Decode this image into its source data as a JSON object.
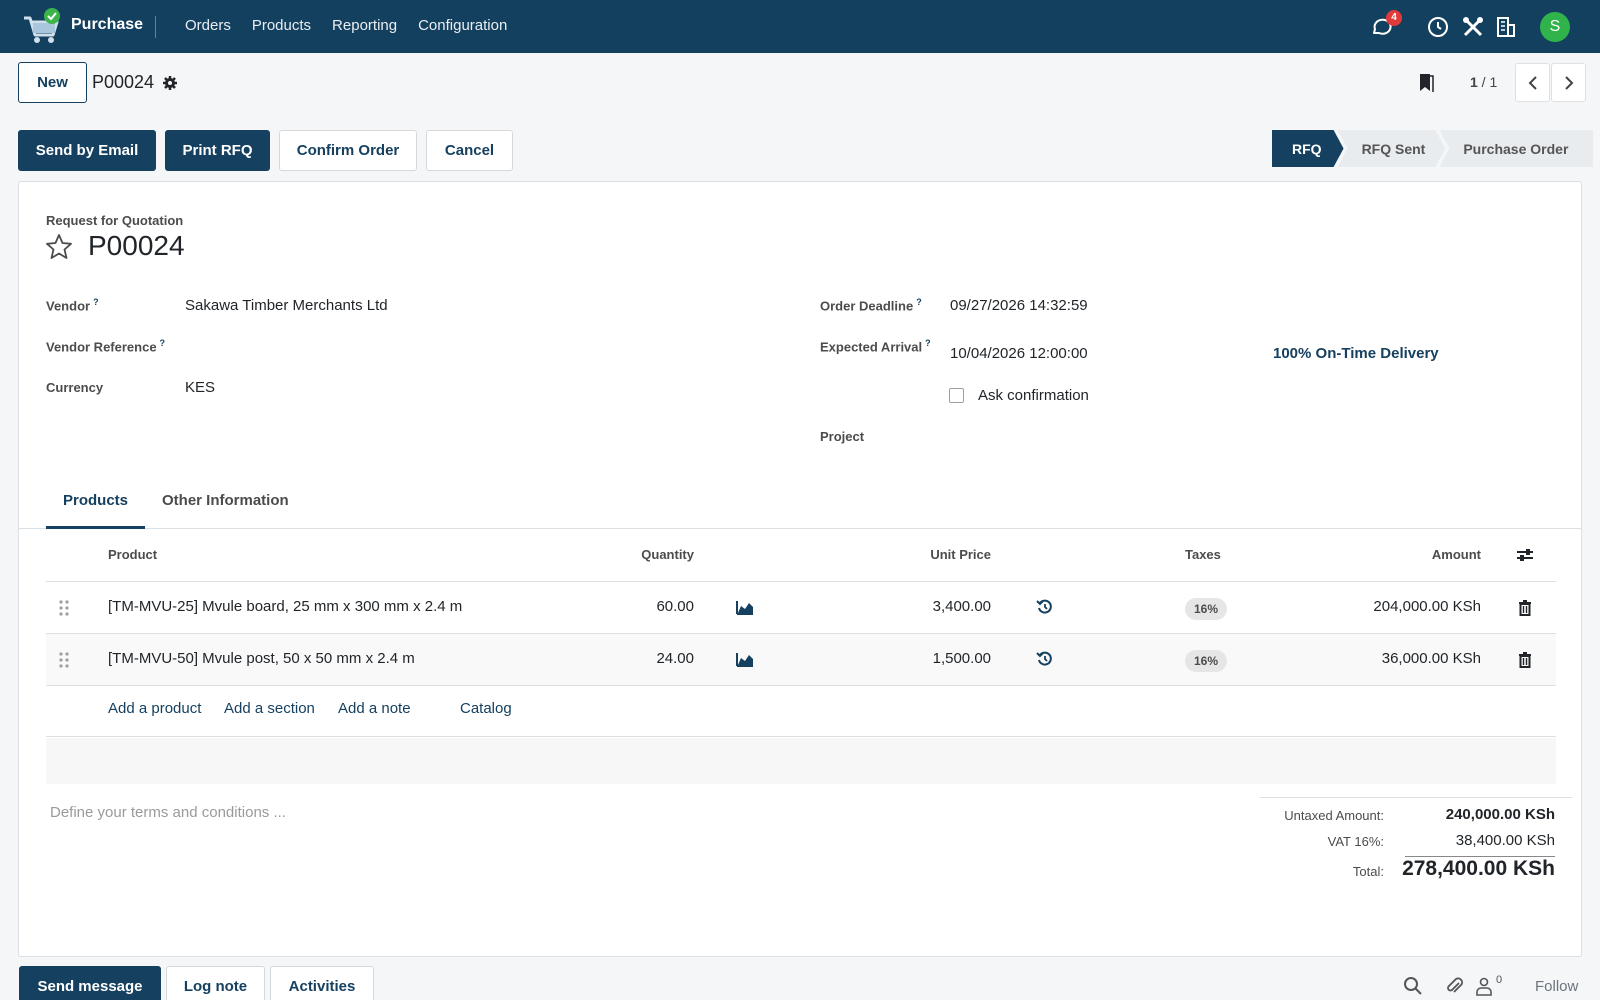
{
  "app": {
    "name": "Purchase",
    "accent": "#15405f"
  },
  "nav": {
    "menu": [
      "Orders",
      "Products",
      "Reporting",
      "Configuration"
    ],
    "messages_badge": "4",
    "avatar_initial": "S",
    "icons": [
      "chat-icon",
      "clock-icon",
      "tools-icon",
      "building-icon"
    ]
  },
  "control": {
    "new_label": "New",
    "record_name": "P00024",
    "pager": {
      "current": "1",
      "total": "1"
    },
    "buttons": {
      "send_email": "Send by Email",
      "print_rfq": "Print RFQ",
      "confirm": "Confirm Order",
      "cancel": "Cancel"
    },
    "stages": [
      "RFQ",
      "RFQ Sent",
      "Purchase Order"
    ]
  },
  "form": {
    "subtitle": "Request for Quotation",
    "name": "P00024",
    "vendor_label": "Vendor",
    "vendor": "Sakawa Timber Merchants Ltd",
    "vendor_ref_label": "Vendor Reference",
    "currency_label": "Currency",
    "currency": "KES",
    "deadline_label": "Order Deadline",
    "deadline": "09/27/2026 14:32:59",
    "arrival_label": "Expected Arrival",
    "arrival": "10/04/2026 12:00:00",
    "on_time": "100% On-Time Delivery",
    "ask_confirmation": "Ask confirmation",
    "project_label": "Project",
    "help_mark": "?"
  },
  "tabs": {
    "products": "Products",
    "other": "Other Information"
  },
  "table": {
    "headers": {
      "product": "Product",
      "quantity": "Quantity",
      "unit_price": "Unit Price",
      "taxes": "Taxes",
      "amount": "Amount"
    },
    "rows": [
      {
        "product": "[TM-MVU-25] Mvule board, 25 mm x 300 mm x 2.4 m",
        "quantity": "60.00",
        "unit_price": "3,400.00",
        "tax": "16%",
        "amount": "204,000.00 KSh"
      },
      {
        "product": "[TM-MVU-50] Mvule post, 50 x 50 mm x 2.4 m",
        "quantity": "24.00",
        "unit_price": "1,500.00",
        "tax": "16%",
        "amount": "36,000.00 KSh"
      }
    ],
    "add": {
      "product": "Add a product",
      "section": "Add a section",
      "note": "Add a note",
      "catalog": "Catalog"
    }
  },
  "terms_placeholder": "Define your terms and conditions ...",
  "totals": {
    "untaxed_label": "Untaxed Amount:",
    "untaxed": "240,000.00 KSh",
    "vat_label": "VAT 16%:",
    "vat": "38,400.00 KSh",
    "total_label": "Total:",
    "total": "278,400.00 KSh"
  },
  "chatter": {
    "send_message": "Send message",
    "log_note": "Log note",
    "activities": "Activities",
    "followers_count": "0",
    "follow": "Follow"
  }
}
